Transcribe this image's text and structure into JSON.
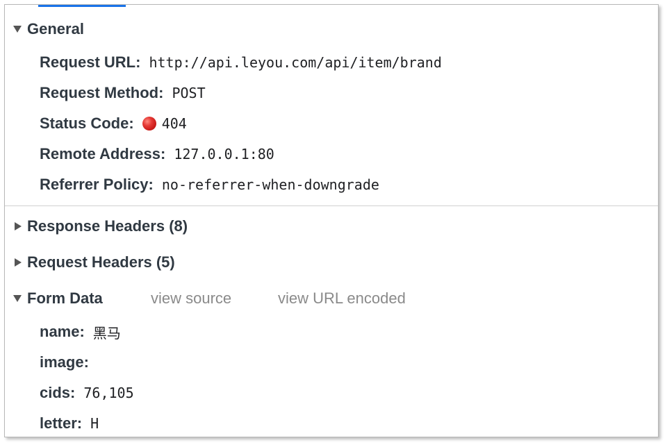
{
  "general": {
    "title": "General",
    "fields": [
      {
        "key": "Request URL:",
        "value": "http://api.leyou.com/api/item/brand"
      },
      {
        "key": "Request Method:",
        "value": "POST"
      },
      {
        "key": "Status Code:",
        "value": "404"
      },
      {
        "key": "Remote Address:",
        "value": "127.0.0.1:80"
      },
      {
        "key": "Referrer Policy:",
        "value": "no-referrer-when-downgrade"
      }
    ],
    "status_color": "#e53935"
  },
  "response_headers": {
    "title": "Response Headers (8)"
  },
  "request_headers": {
    "title": "Request Headers (5)"
  },
  "form_data": {
    "title": "Form Data",
    "view_source": "view source",
    "view_url_encoded": "view URL encoded",
    "fields": [
      {
        "key": "name:",
        "value": "黑马"
      },
      {
        "key": "image:",
        "value": ""
      },
      {
        "key": "cids:",
        "value": "76,105"
      },
      {
        "key": "letter:",
        "value": "H"
      }
    ]
  },
  "accent_color": "#1a73e8"
}
